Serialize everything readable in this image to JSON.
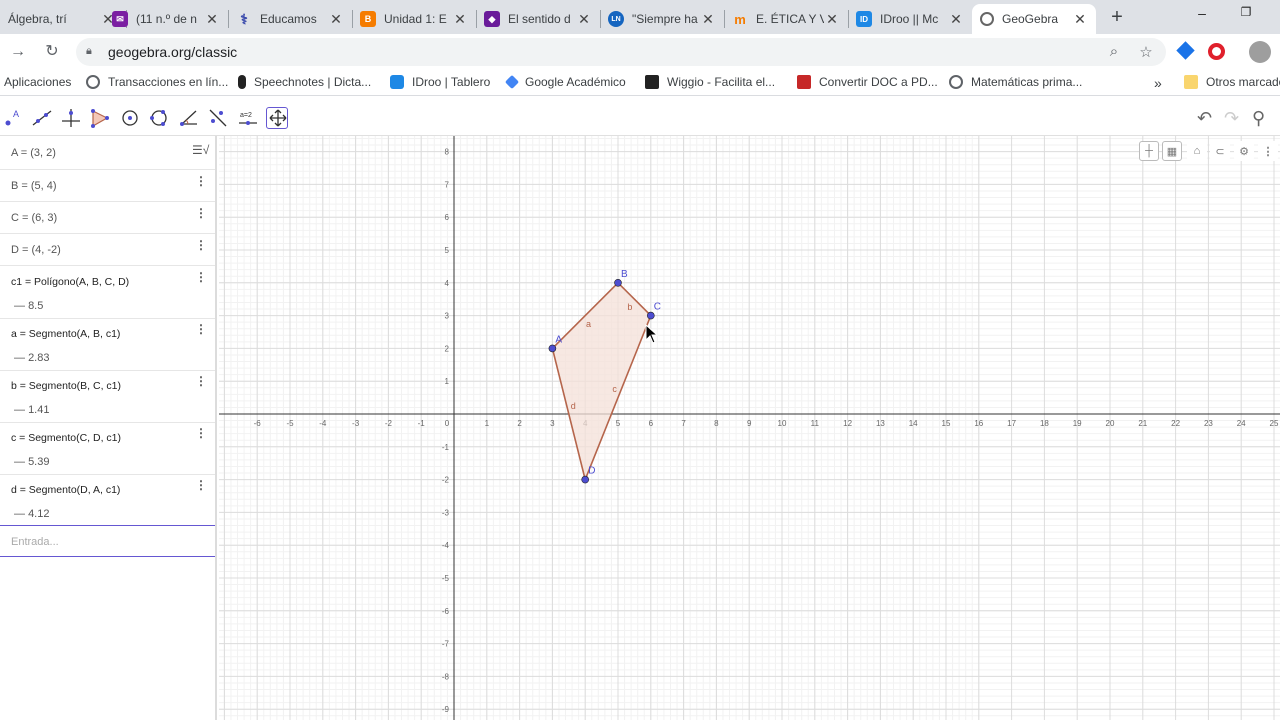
{
  "browser": {
    "tabs": [
      {
        "title": "Álgebra, trí",
        "icon": "graduation-cap-icon",
        "color": "#5f6368"
      },
      {
        "title": "(11 n.º de n",
        "icon": "mail-icon",
        "color": "#7b1fa2"
      },
      {
        "title": "Educamos",
        "icon": "caduceus-icon",
        "color": "#3949ab"
      },
      {
        "title": "Unidad 1: E",
        "icon": "blogger-icon",
        "color": "#f57c00"
      },
      {
        "title": "El sentido d",
        "icon": "app-icon",
        "color": "#6a1b9a"
      },
      {
        "title": "\"Siempre ha",
        "icon": "ln-icon",
        "color": "#1565c0"
      },
      {
        "title": "E. ÉTICA Y V",
        "icon": "moodle-icon",
        "color": "#f57c00"
      },
      {
        "title": "IDroo || Mc",
        "icon": "idroo-icon",
        "color": "#1e88e5"
      },
      {
        "title": "GeoGebra",
        "icon": "geogebra-icon",
        "color": "#666666"
      }
    ],
    "url": "geogebra.org/classic",
    "bookmarks": [
      {
        "label": "Aplicaciones",
        "icon": "apps-icon",
        "color": "#5f6368"
      },
      {
        "label": "Transacciones en lín...",
        "icon": "globe-icon",
        "color": "#5f6368"
      },
      {
        "label": "Speechnotes | Dicta...",
        "icon": "microphone-icon",
        "color": "#222222"
      },
      {
        "label": "IDroo | Tablero",
        "icon": "idroo-icon",
        "color": "#1e88e5"
      },
      {
        "label": "Google Académico",
        "icon": "scholar-icon",
        "color": "#4285f4"
      },
      {
        "label": "Wiggio - Facilita el...",
        "icon": "wiggio-icon",
        "color": "#222222"
      },
      {
        "label": "Convertir DOC a PD...",
        "icon": "convert-icon",
        "color": "#c62828"
      },
      {
        "label": "Matemáticas prima...",
        "icon": "globe-icon",
        "color": "#5f6368"
      }
    ],
    "bookmarks_overflow": "»",
    "other_bookmarks": "Otros marcadores"
  },
  "algebra": {
    "items": [
      {
        "def": "A = (3, 2)",
        "value": ""
      },
      {
        "def": "B = (5, 4)",
        "value": ""
      },
      {
        "def": "C = (6, 3)",
        "value": ""
      },
      {
        "def": "D = (4, -2)",
        "value": ""
      },
      {
        "def": "c1 = Polígono(A, B, C, D)",
        "value": "8.5"
      },
      {
        "def": "a = Segmento(A, B, c1)",
        "value": "2.83"
      },
      {
        "def": "b = Segmento(B, C, c1)",
        "value": "1.41"
      },
      {
        "def": "c = Segmento(C, D, c1)",
        "value": "5.39"
      },
      {
        "def": "d = Segmento(D, A, c1)",
        "value": "4.12"
      }
    ],
    "input_placeholder": "Entrada..."
  },
  "graph": {
    "points": [
      {
        "name": "A",
        "x": 3,
        "y": 2
      },
      {
        "name": "B",
        "x": 5,
        "y": 4
      },
      {
        "name": "C",
        "x": 6,
        "y": 3
      },
      {
        "name": "D",
        "x": 4,
        "y": -2
      }
    ],
    "segments": [
      {
        "name": "a",
        "from": "A",
        "to": "B"
      },
      {
        "name": "b",
        "from": "B",
        "to": "C"
      },
      {
        "name": "c",
        "from": "C",
        "to": "D"
      },
      {
        "name": "d",
        "from": "D",
        "to": "A"
      }
    ],
    "x_ticks": [
      -6,
      -5,
      -4,
      -3,
      -2,
      -1,
      0,
      1,
      2,
      3,
      4,
      5,
      6,
      7,
      8,
      9,
      10,
      11,
      12,
      13,
      14,
      15,
      16,
      17,
      18,
      19,
      20,
      21,
      22,
      23,
      24,
      25
    ],
    "y_ticks": [
      8,
      7,
      6,
      5,
      4,
      3,
      2,
      1,
      -1,
      -2,
      -3,
      -4,
      -5,
      -6,
      -7,
      -8,
      -9
    ],
    "colors": {
      "polygon_fill": "#f4e0d8",
      "polygon_stroke": "#b5654b",
      "point": "#4d4dd0",
      "point_label": "#4d4dd0",
      "segment_label": "#b5654b"
    }
  }
}
